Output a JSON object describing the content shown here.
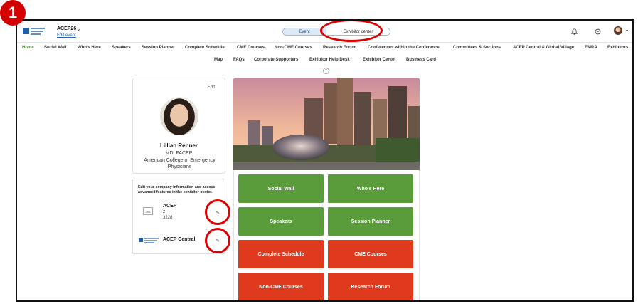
{
  "step_badge": "1",
  "colors": {
    "accent_green": "#5a9b3c",
    "accent_red": "#e03a1e",
    "highlight_ring": "#e00000",
    "link_blue": "#2c5fb3"
  },
  "header": {
    "event_name": "ACEP26",
    "edit_event": "Edit event",
    "switch_event": "Event",
    "switch_exhibitor": "Exhibitor center",
    "icons": [
      "bell-icon",
      "chat-icon",
      "avatar",
      "chevron-down-icon"
    ]
  },
  "nav": {
    "row1": [
      "Home",
      "Social Wall",
      "Who's Here",
      "Speakers",
      "Session Planner",
      "Complete Schedule",
      "CME Courses",
      "Non-CME Courses",
      "Research Forum",
      "Conferences within the Conference",
      "Committees & Sections",
      "ACEP Central & Global Village",
      "EMRA",
      "Exhibitors"
    ],
    "row2": [
      "Map",
      "FAQs",
      "Corporate Supporters",
      "Exhibitor Help Desk",
      "Exhibitor Center",
      "Business Card"
    ],
    "active": "Home"
  },
  "profile": {
    "edit": "Edit",
    "name": "Lillian Renner",
    "title": "MD, FACEP",
    "org": "American College of Emergency Physicians"
  },
  "company": {
    "note": "Edit your company information and access advanced features in the exhibitor center.",
    "items": [
      {
        "name": "ACEP",
        "line1": "2",
        "line2": "3228"
      },
      {
        "name": "ACEP Central"
      }
    ]
  },
  "tiles": [
    {
      "label": "Social Wall",
      "color": "green"
    },
    {
      "label": "Who's Here",
      "color": "green"
    },
    {
      "label": "Speakers",
      "color": "green"
    },
    {
      "label": "Session Planner",
      "color": "green"
    },
    {
      "label": "Complete Schedule",
      "color": "red"
    },
    {
      "label": "CME Courses",
      "color": "red"
    },
    {
      "label": "Non-CME Courses",
      "color": "red"
    },
    {
      "label": "Research Forum",
      "color": "red"
    }
  ]
}
